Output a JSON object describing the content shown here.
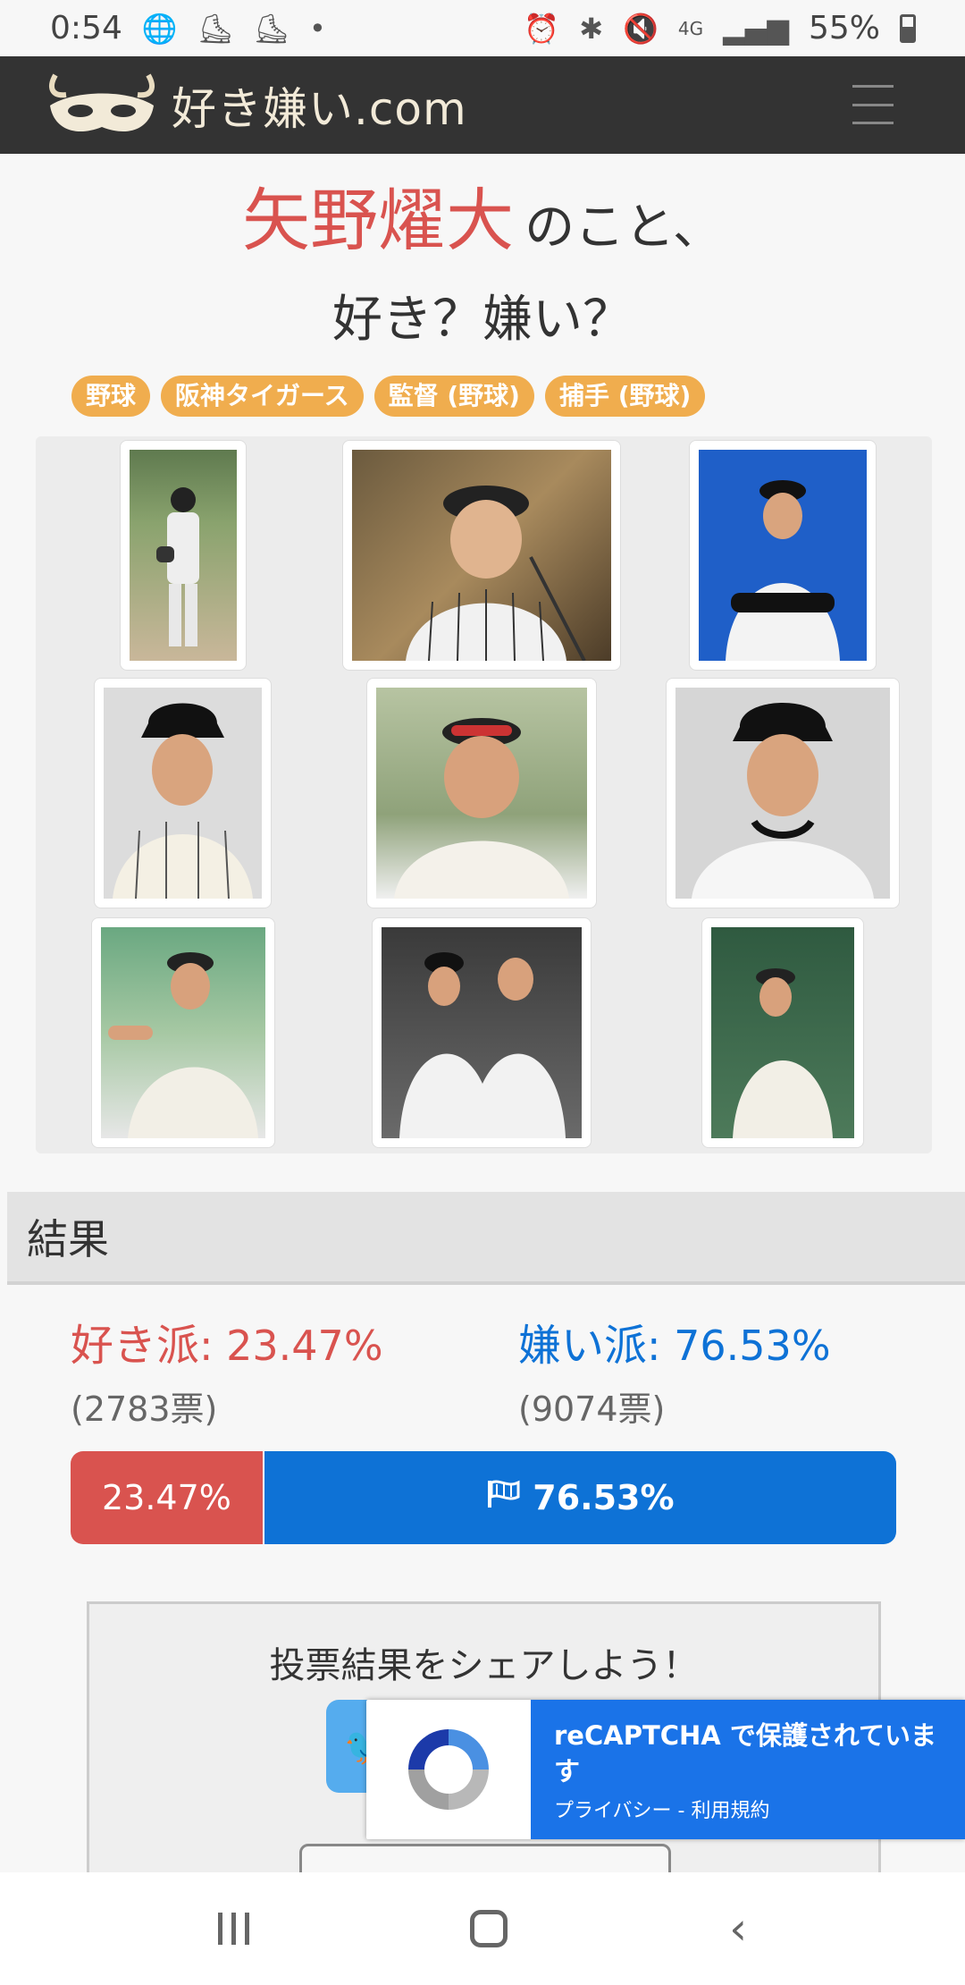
{
  "status_bar": {
    "time": "0:54",
    "battery": "55%",
    "left_icons": [
      "globe-icon",
      "app-icon",
      "app-icon",
      "dot-icon"
    ],
    "right_icons": [
      "alarm-icon",
      "bluetooth-icon",
      "mute-icon",
      "4g-icon",
      "signal-icon"
    ],
    "network": "4G"
  },
  "header": {
    "logo_text": "好き嫌い.com",
    "menu_icon": "hamburger-icon"
  },
  "title": {
    "name": "矢野燿大",
    "suffix": "のこと、",
    "question": "好き？嫌い？"
  },
  "tags": [
    "野球",
    "阪神タイガース",
    "監督 (野球)",
    "捕手 (野球)"
  ],
  "results": {
    "heading": "結果",
    "like_label": "好き派",
    "like_pct": ": 23.47%",
    "like_votes": "(2783票)",
    "dislike_label": "嫌い派",
    "dislike_pct": ": 76.53%",
    "dislike_votes": "(9074票)",
    "bar_like_text": "23.47%",
    "bar_dislike_text": "76.53%",
    "like_fraction": 0.2347,
    "colors": {
      "like": "#d9534f",
      "dislike": "#0e72d6"
    }
  },
  "share": {
    "title": "投票結果をシェアしよう！",
    "twitter_icon": "twitter-bird-icon"
  },
  "recaptcha": {
    "title": "reCAPTCHA で保護されています",
    "links": "プライバシー - 利用規約"
  },
  "android_nav": {
    "recent": "recent-apps-icon",
    "home": "home-icon",
    "back": "back-icon"
  }
}
